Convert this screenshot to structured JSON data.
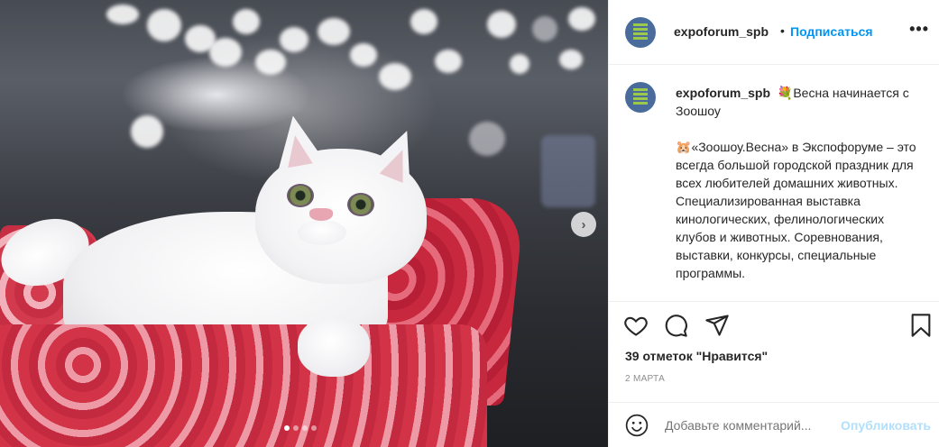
{
  "post": {
    "username": "expoforum_spb",
    "separator": "•",
    "follow_label": "Подписаться",
    "more_icon": "•••",
    "caption": {
      "emoji_bouquet": "💐",
      "lead": "Весна начинается с Зоошоу",
      "emoji_hamster": "🐹",
      "body": "«Зоошоу.Весна» в Экспофоруме – это всегда большой городской праздник для всех любителей домашних животных. Специализированная выставка кинологических, фелинологических клубов и животных. Соревнования, выставки, конкурсы, специальные программы."
    },
    "likes_text": "39 отметок \"Нравится\"",
    "date_text": "2 МАРТА",
    "comment_placeholder": "Добавьте комментарий...",
    "publish_label": "Опубликовать"
  },
  "carousel": {
    "next_arrow": "›",
    "slide_count": 4,
    "active_slide": 1
  },
  "colors": {
    "accent": "#0095f6",
    "publish_disabled": "#b2dffc",
    "muted": "#8e8e8e",
    "avatar_bg": "#4a6c9c",
    "avatar_bars": "#9cc94a"
  }
}
